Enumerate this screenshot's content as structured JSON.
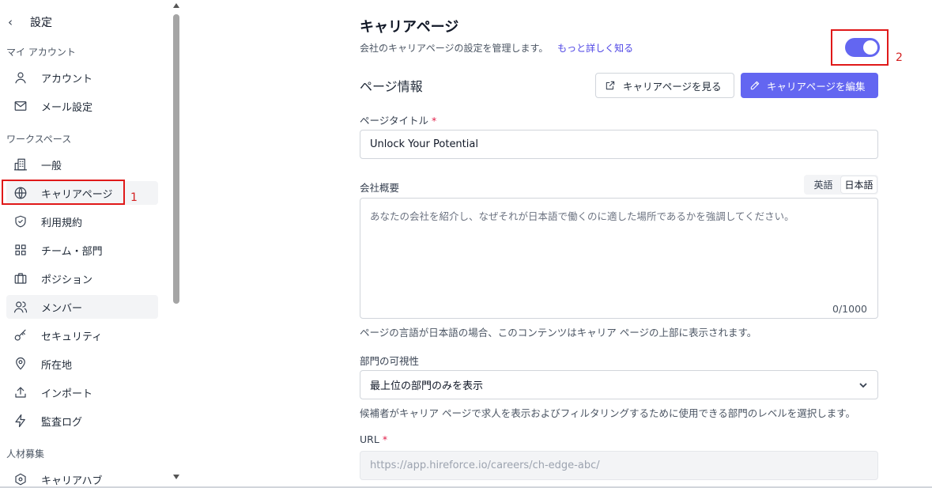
{
  "sidebar": {
    "header": {
      "back_icon": "chevron-left-icon",
      "title": "設定"
    },
    "sections": {
      "my_account": "マイ アカウント",
      "workspace": "ワークスペース",
      "recruiting": "人材募集"
    },
    "items": [
      {
        "label": "アカウント",
        "icon": "user-icon"
      },
      {
        "label": "メール設定",
        "icon": "mail-icon"
      },
      {
        "label": "一般",
        "icon": "building-icon"
      },
      {
        "label": "キャリアページ",
        "icon": "globe-icon"
      },
      {
        "label": "利用規約",
        "icon": "shield-check-icon"
      },
      {
        "label": "チーム・部門",
        "icon": "grid-icon"
      },
      {
        "label": "ポジション",
        "icon": "briefcase-icon"
      },
      {
        "label": "メンバー",
        "icon": "users-icon"
      },
      {
        "label": "セキュリティ",
        "icon": "key-icon"
      },
      {
        "label": "所在地",
        "icon": "map-pin-icon"
      },
      {
        "label": "インポート",
        "icon": "upload-icon"
      },
      {
        "label": "監査ログ",
        "icon": "zap-icon"
      },
      {
        "label": "キャリアハブ",
        "icon": "hub-icon"
      }
    ]
  },
  "annotations": {
    "one": "1",
    "two": "2"
  },
  "main": {
    "title": "キャリアページ",
    "description": "会社のキャリアページの設定を管理します。",
    "learn_more": "もっと詳しく知る",
    "toggle_enabled": true,
    "section_title": "ページ情報",
    "view_button": "キャリアページを見る",
    "edit_button": "キャリアページを編集",
    "page_title_label": "ページタイトル",
    "required_mark": "*",
    "page_title_value": "Unlock Your Potential",
    "overview_label": "会社概要",
    "lang_tabs": [
      "英語",
      "日本語"
    ],
    "active_lang": "日本語",
    "overview_placeholder": "あなたの会社を紹介し、なぜそれが日本語で働くのに適した場所であるかを強調してください。",
    "char_count": "0/1000",
    "overview_help": "ページの言語が日本語の場合、このコンテンツはキャリア ページの上部に表示されます。",
    "visibility_label": "部門の可視性",
    "visibility_value": "最上位の部門のみを表示",
    "visibility_help": "候補者がキャリア ページで求人を表示およびフィルタリングするために使用できる部門のレベルを選択します。",
    "url_label": "URL",
    "url_value": "https://app.hireforce.io/careers/ch-edge-abc/"
  },
  "colors": {
    "accent": "#6366f1",
    "annotation": "#e01919"
  }
}
